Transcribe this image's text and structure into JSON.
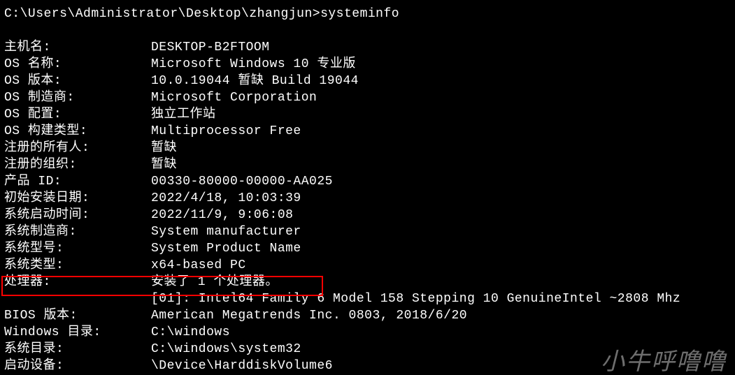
{
  "prompt": "C:\\Users\\Administrator\\Desktop\\zhangjun>systeminfo",
  "rows": [
    {
      "label": "主机名:",
      "value": "DESKTOP-B2FTOOM"
    },
    {
      "label": "OS 名称:",
      "value": "Microsoft Windows 10 专业版"
    },
    {
      "label": "OS 版本:",
      "value": "10.0.19044 暂缺 Build 19044"
    },
    {
      "label": "OS 制造商:",
      "value": "Microsoft Corporation"
    },
    {
      "label": "OS 配置:",
      "value": "独立工作站"
    },
    {
      "label": "OS 构建类型:",
      "value": "Multiprocessor Free"
    },
    {
      "label": "注册的所有人:",
      "value": "暂缺"
    },
    {
      "label": "注册的组织:",
      "value": "暂缺"
    },
    {
      "label": "产品 ID:",
      "value": "00330-80000-00000-AA025"
    },
    {
      "label": "初始安装日期:",
      "value": "2022/4/18, 10:03:39"
    },
    {
      "label": "系统启动时间:",
      "value": "2022/11/9, 9:06:08"
    },
    {
      "label": "系统制造商:",
      "value": "System manufacturer"
    },
    {
      "label": "系统型号:",
      "value": "System Product Name"
    },
    {
      "label": "系统类型:",
      "value": "x64-based PC"
    },
    {
      "label": "处理器:",
      "value": "安装了 1 个处理器。"
    },
    {
      "label": "",
      "value": "[01]: Intel64 Family 6 Model 158 Stepping 10 GenuineIntel ~2808 Mhz"
    },
    {
      "label": "BIOS 版本:",
      "value": "American Megatrends Inc. 0803, 2018/6/20"
    },
    {
      "label": "Windows 目录:",
      "value": "C:\\windows"
    },
    {
      "label": "系统目录:",
      "value": "C:\\windows\\system32"
    },
    {
      "label": "启动设备:",
      "value": "\\Device\\HarddiskVolume6"
    }
  ],
  "watermark": "小牛呼噜噜"
}
